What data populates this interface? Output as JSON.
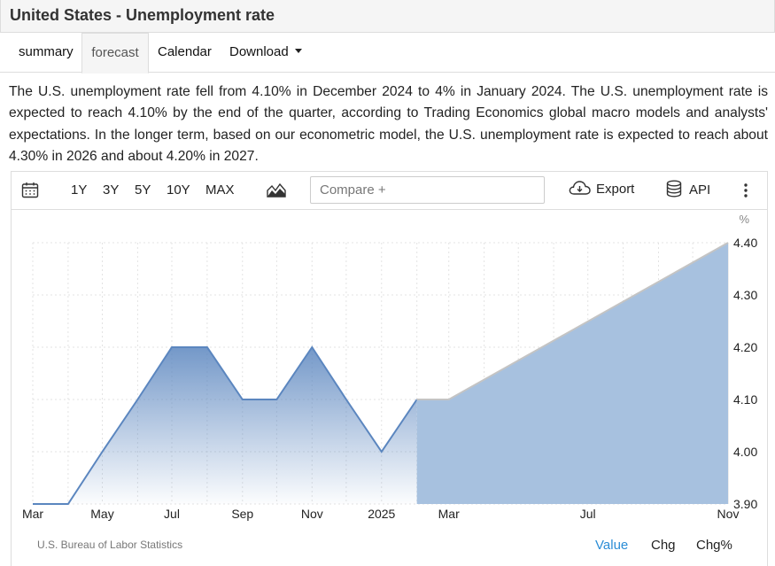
{
  "page": {
    "title": "United States - Unemployment rate",
    "tabs": [
      {
        "label": "summary"
      },
      {
        "label": "forecast"
      },
      {
        "label": "Calendar"
      },
      {
        "label": "Download"
      }
    ],
    "description": "The U.S. unemployment rate fell from 4.10% in December 2024 to 4% in January 2024. The U.S. unemployment rate is expected to reach 4.10% by the end of the quarter, according to Trading Economics global macro models and analysts' expectations. In the longer term, based on our econometric model, the U.S. unemployment rate is expected to reach about 4.30% in 2026 and about 4.20% in 2027."
  },
  "toolbar": {
    "ranges": [
      "1Y",
      "3Y",
      "5Y",
      "10Y",
      "MAX"
    ],
    "compare_placeholder": "Compare +",
    "export_label": "Export",
    "api_label": "API"
  },
  "footer": {
    "source": "U.S. Bureau of Labor Statistics",
    "value_label": "Value",
    "chg_label": "Chg",
    "chgpct_label": "Chg%"
  },
  "colors": {
    "line": "#5b86bf",
    "forecast_fill": "#a7c1df",
    "active_footer": "#2b8dd6"
  },
  "chart_data": {
    "type": "area",
    "unit_label": "%",
    "x_ticks": [
      "Mar",
      "May",
      "Jul",
      "Sep",
      "Nov",
      "2025",
      "Mar",
      "Jul",
      "Nov"
    ],
    "y_ticks": [
      "3.90",
      "4.00",
      "4.10",
      "4.20",
      "4.30",
      "4.40"
    ],
    "ylim": [
      3.9,
      4.4
    ],
    "grid": true,
    "historical": {
      "x": [
        "2024-03",
        "2024-04",
        "2024-05",
        "2024-06",
        "2024-07",
        "2024-08",
        "2024-09",
        "2024-10",
        "2024-11",
        "2024-12",
        "2025-01",
        "2025-02"
      ],
      "values": [
        3.9,
        3.9,
        4.0,
        4.1,
        4.2,
        4.2,
        4.1,
        4.1,
        4.2,
        4.1,
        4.0,
        4.1
      ]
    },
    "forecast": {
      "x": [
        "2025-02",
        "2025-03",
        "2025-11"
      ],
      "values": [
        4.1,
        4.1,
        4.4
      ]
    }
  }
}
